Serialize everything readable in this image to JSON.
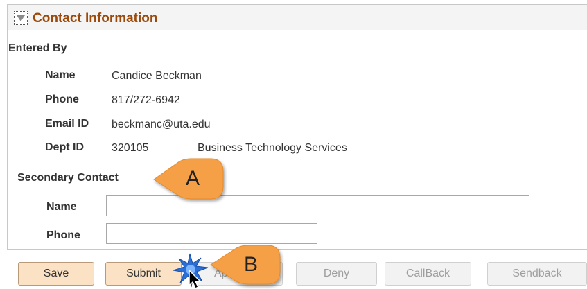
{
  "panel": {
    "title": "Contact Information",
    "collapse_icon": "triangle-down-icon"
  },
  "entered_by": {
    "heading": "Entered By",
    "name_label": "Name",
    "name_value": "Candice Beckman",
    "phone_label": "Phone",
    "phone_value": "817/272-6942",
    "email_label": "Email ID",
    "email_value": "beckmanc@uta.edu",
    "dept_label": "Dept ID",
    "dept_id_value": "320105",
    "dept_name_value": "Business Technology Services"
  },
  "secondary_contact": {
    "heading": "Secondary Contact",
    "name_label": "Name",
    "name_value": "",
    "phone_label": "Phone",
    "phone_value": ""
  },
  "buttons": {
    "save": "Save",
    "submit": "Submit",
    "approve_partial": "Ap",
    "deny": "Deny",
    "callback": "CallBack",
    "sendback": "Sendback"
  },
  "callouts": {
    "a": "A",
    "b": "B"
  },
  "colors": {
    "title": "#9c4a0c",
    "callout_fill": "#f5a047",
    "primary_button": "#fbe2c4",
    "click_burst": "#2a6fd6"
  }
}
